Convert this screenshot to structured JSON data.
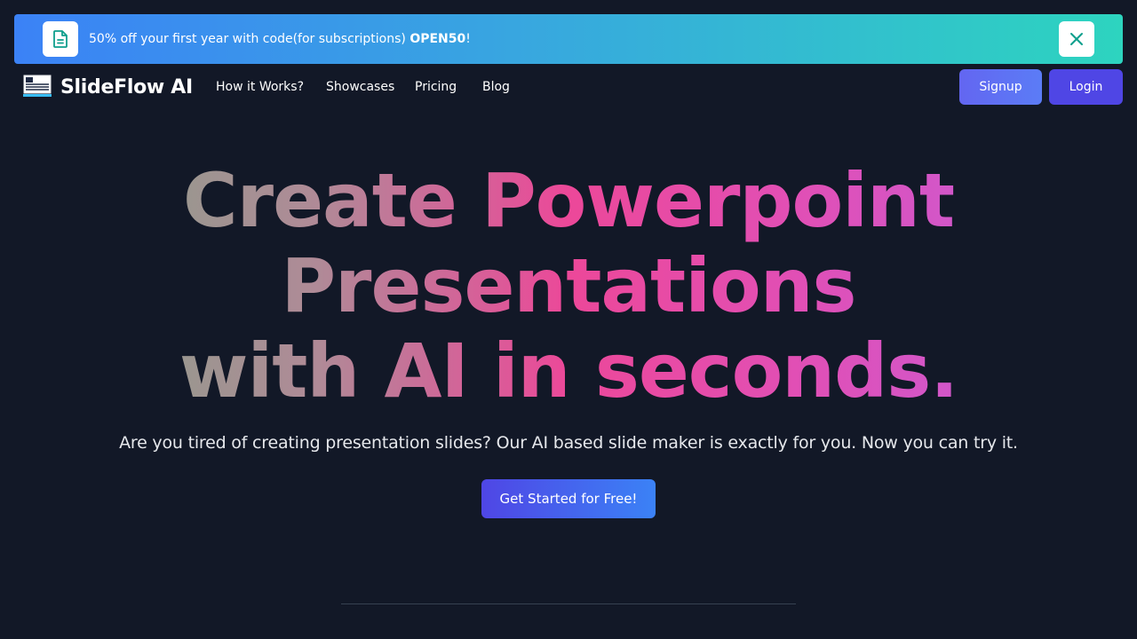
{
  "banner": {
    "text_prefix": "50% off your first year with code(for subscriptions) ",
    "code": "OPEN50",
    "text_suffix": "!",
    "icon": "document-icon",
    "close_icon": "close-icon"
  },
  "nav": {
    "brand": "SlideFlow AI",
    "links": [
      "How it Works?",
      "Showcases",
      "Pricing",
      "Blog"
    ],
    "signup": "Signup",
    "login": "Login"
  },
  "hero": {
    "line1": "Create Powerpoint",
    "line2": "Presentations",
    "line3": "with AI in seconds.",
    "subtitle": "Are you tired of creating presentation slides? Our AI based slide maker is exactly for you. Now you can try it.",
    "cta": "Get Started for Free!"
  },
  "colors": {
    "background": "#121827",
    "accent": "#4f46e5",
    "banner_start": "#3b82f6",
    "banner_end": "#2dd4bf",
    "heading_gradient": [
      "#7fa686",
      "#ec4899",
      "#c15fe0"
    ]
  }
}
